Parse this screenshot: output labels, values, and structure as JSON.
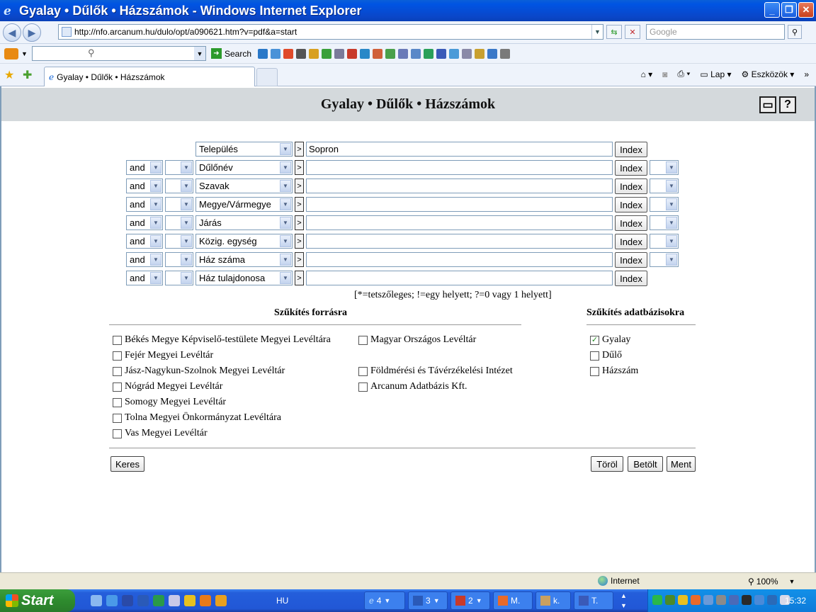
{
  "window": {
    "title": "Gyalay • Dűlők • Házszámok - Windows Internet Explorer"
  },
  "address": {
    "url": "http://nfo.arcanum.hu/dulo/opt/a090621.htm?v=pdf&a=start",
    "search_placeholder": "Google"
  },
  "toolbar": {
    "search_label": "Search"
  },
  "tabs": {
    "active_label": "Gyalay • Dűlők • Házszámok"
  },
  "commands": {
    "page_label": "Lap",
    "tools_label": "Eszközök"
  },
  "page": {
    "title": "Gyalay • Dűlők • Házszámok",
    "hint": "[*=tetszőleges; !=egy helyett; ?=0 vagy 1 helyett]",
    "index_label": "Index",
    "query_rows": [
      {
        "op": "",
        "field": "Település",
        "value": "Sopron"
      },
      {
        "op": "and",
        "field": "Dűlőnév",
        "value": ""
      },
      {
        "op": "and",
        "field": "Szavak",
        "value": ""
      },
      {
        "op": "and",
        "field": "Megye/Vármegye",
        "value": ""
      },
      {
        "op": "and",
        "field": "Járás",
        "value": ""
      },
      {
        "op": "and",
        "field": "Közig. egység",
        "value": ""
      },
      {
        "op": "and",
        "field": "Ház száma",
        "value": ""
      },
      {
        "op": "and",
        "field": "Ház tulajdonosa",
        "value": ""
      }
    ],
    "sources_title": "Szűkítés forrásra",
    "databases_title": "Szűkítés adatbázisokra",
    "sources_left": [
      "Békés Megye Képviselő-testülete Megyei Levéltára",
      "Fejér Megyei Levéltár",
      "Jász-Nagykun-Szolnok Megyei Levéltár",
      "Nógrád Megyei Levéltár",
      "Somogy Megyei Levéltár",
      "Tolna Megyei Önkormányzat Levéltára",
      "Vas Megyei Levéltár"
    ],
    "sources_right": [
      "Magyar Országos Levéltár",
      "Földmérési és Távérzékelési Intézet",
      "Arcanum Adatbázis Kft."
    ],
    "databases": [
      {
        "label": "Gyalay",
        "checked": true
      },
      {
        "label": "Dűlő",
        "checked": false
      },
      {
        "label": "Házszám",
        "checked": false
      }
    ],
    "buttons": {
      "search": "Keres",
      "clear": "Töröl",
      "load": "Betölt",
      "save": "Ment"
    }
  },
  "statusbar": {
    "zone": "Internet",
    "zoom": "100%"
  },
  "taskbar": {
    "start": "Start",
    "lang": "HU",
    "tasks": [
      {
        "label": "4"
      },
      {
        "label": "3"
      },
      {
        "label": "2"
      },
      {
        "label": "M."
      },
      {
        "label": "k."
      },
      {
        "label": "T."
      }
    ],
    "time": "15:32"
  }
}
